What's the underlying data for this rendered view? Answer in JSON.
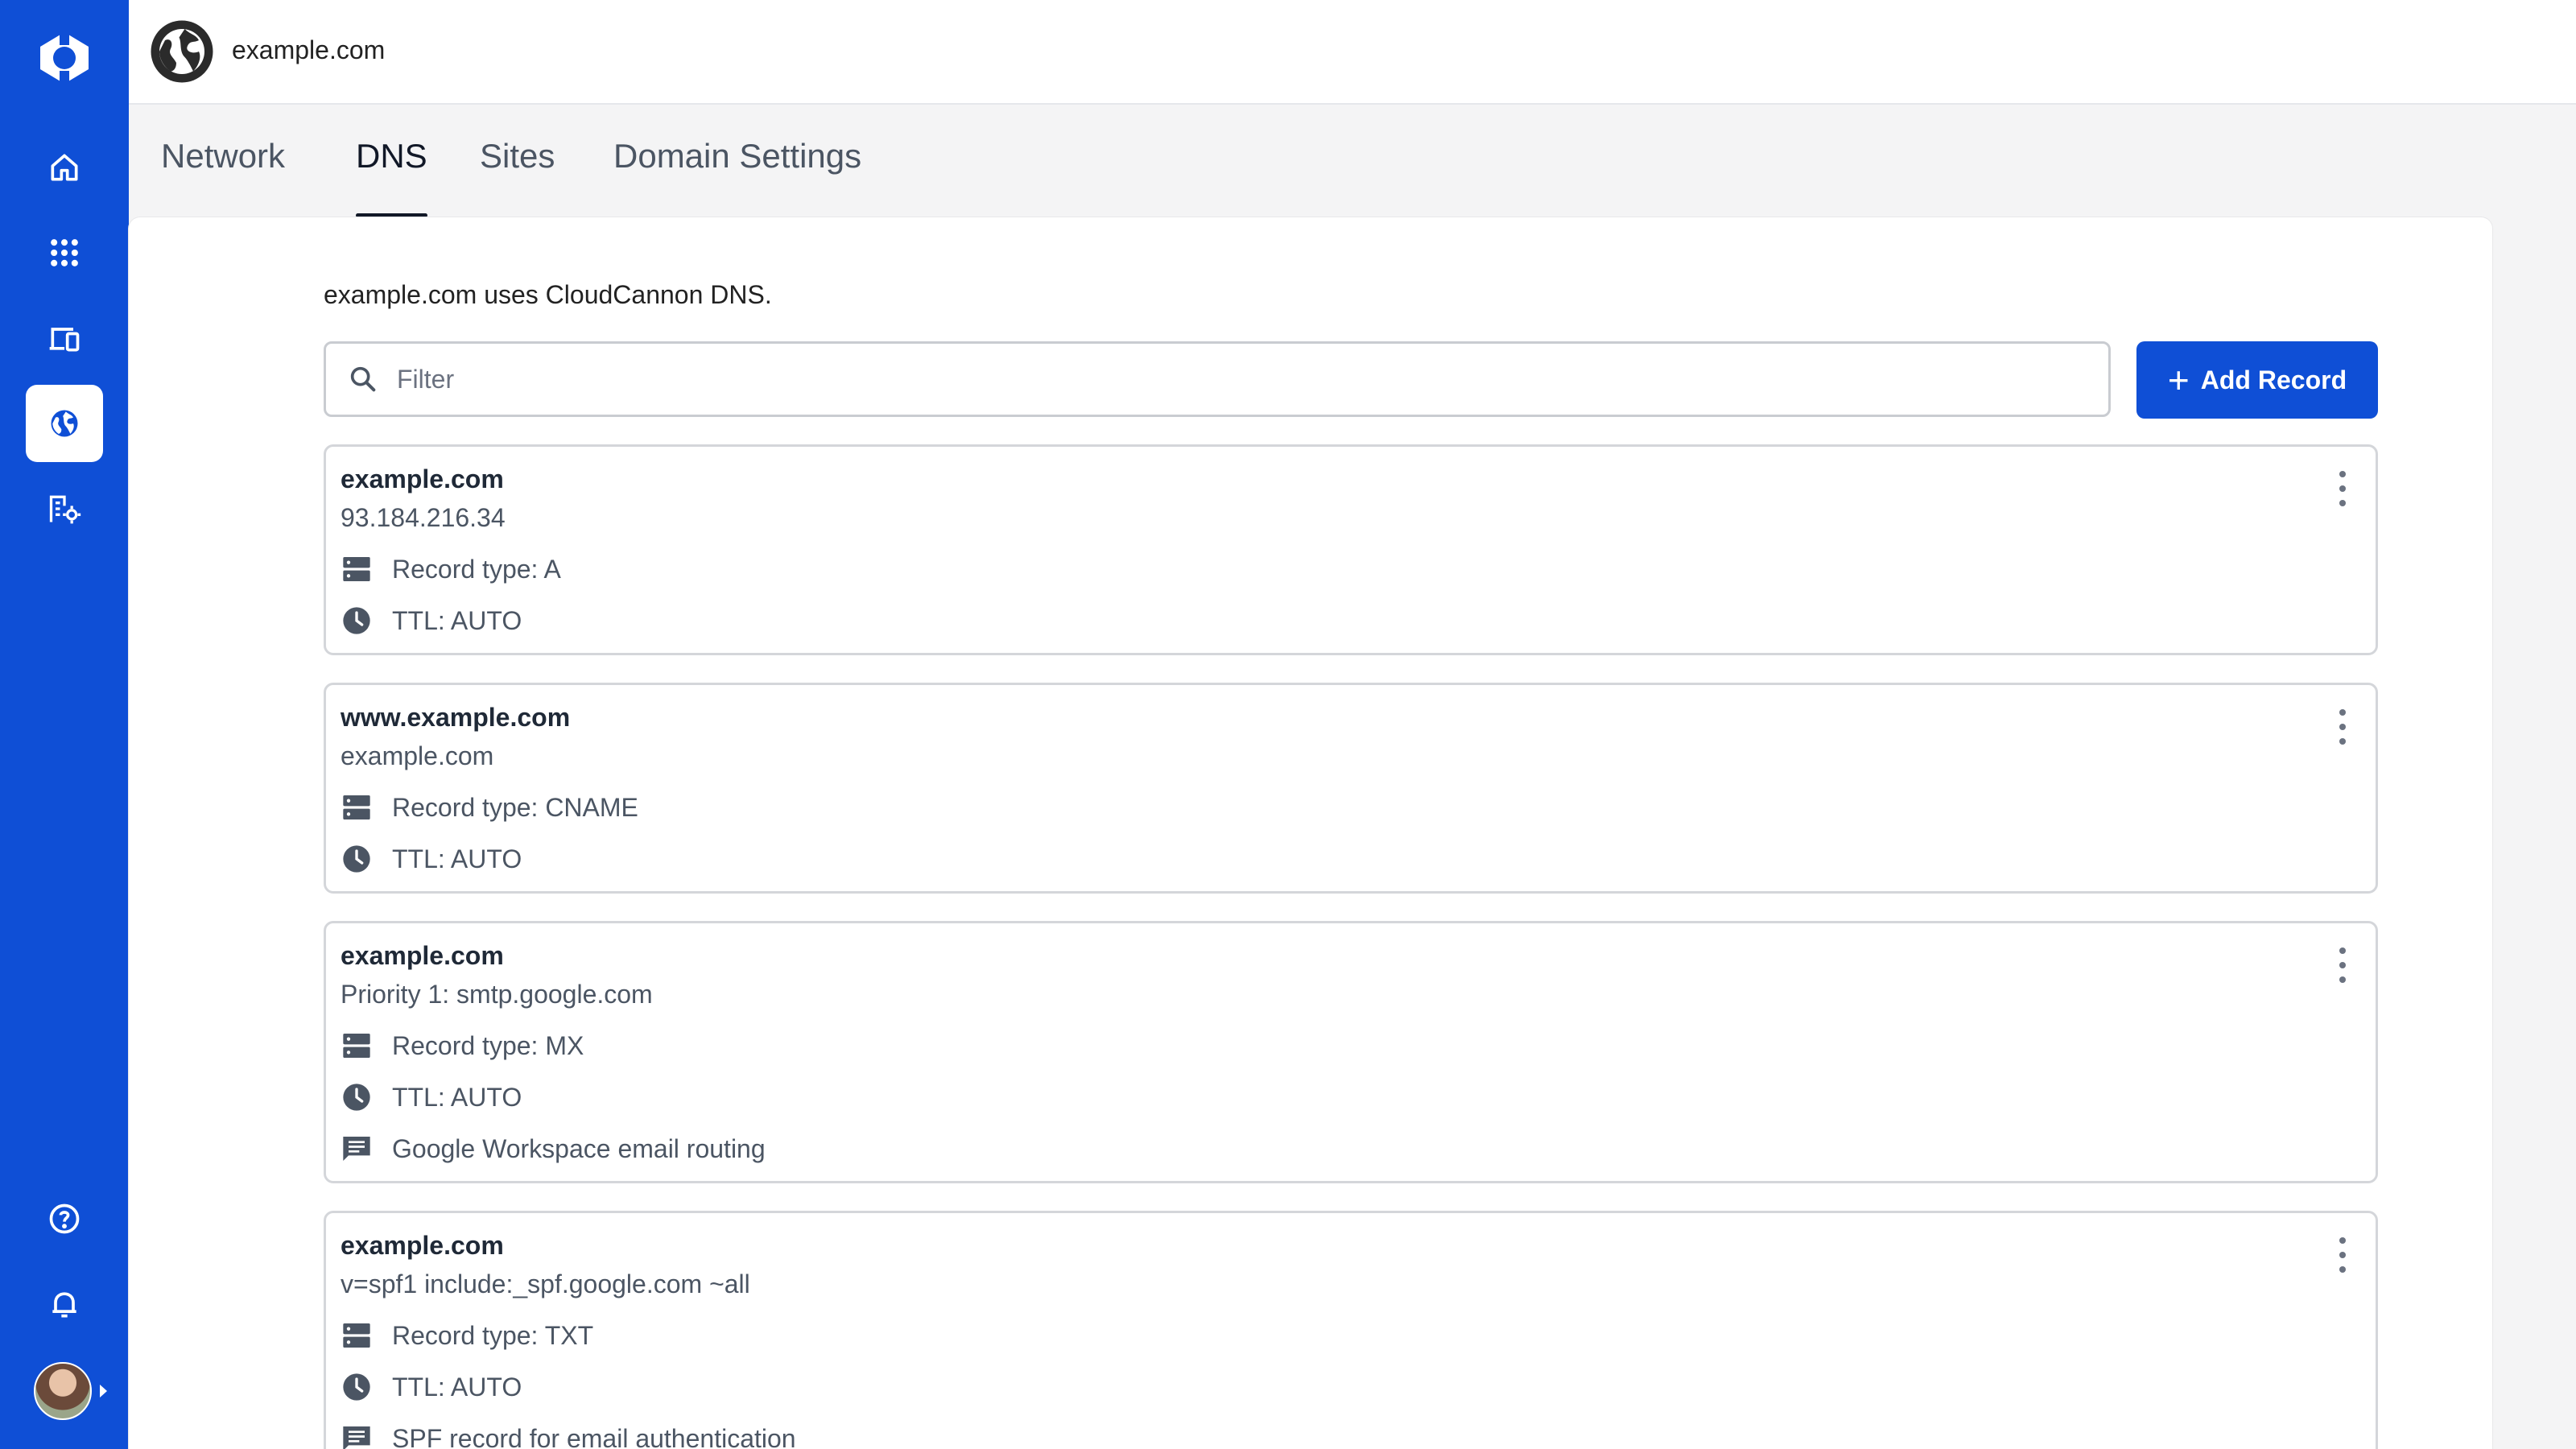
{
  "colors": {
    "brand": "#0f4fd6",
    "rail": "#0f4fd6"
  },
  "header": {
    "site_title": "example.com"
  },
  "tabs": [
    {
      "label": "Network",
      "active": false
    },
    {
      "label": "DNS",
      "active": true
    },
    {
      "label": "Sites",
      "active": false
    },
    {
      "label": "Domain Settings",
      "active": false
    }
  ],
  "nav": {
    "items": [
      "home-icon",
      "apps-grid-icon",
      "devices-icon",
      "globe-icon",
      "organization-settings-icon"
    ],
    "bottom": [
      "help-icon",
      "bell-icon",
      "avatar"
    ]
  },
  "dns": {
    "note": "example.com uses CloudCannon DNS.",
    "filter_placeholder": "Filter",
    "add_label": "Add Record"
  },
  "records": [
    {
      "name": "example.com",
      "value": "93.184.216.34",
      "type": "Record type: A",
      "ttl": "TTL: AUTO"
    },
    {
      "name": "www.example.com",
      "value": "example.com",
      "type": "Record type: CNAME",
      "ttl": "TTL: AUTO"
    },
    {
      "name": "example.com",
      "value": "Priority 1: smtp.google.com",
      "type": "Record type: MX",
      "ttl": "TTL: AUTO",
      "comment": "Google Workspace email routing"
    },
    {
      "name": "example.com",
      "value": "v=spf1 include:_spf.google.com ~all",
      "type": "Record type: TXT",
      "ttl": "TTL: AUTO",
      "comment": "SPF record for email authentication"
    }
  ]
}
